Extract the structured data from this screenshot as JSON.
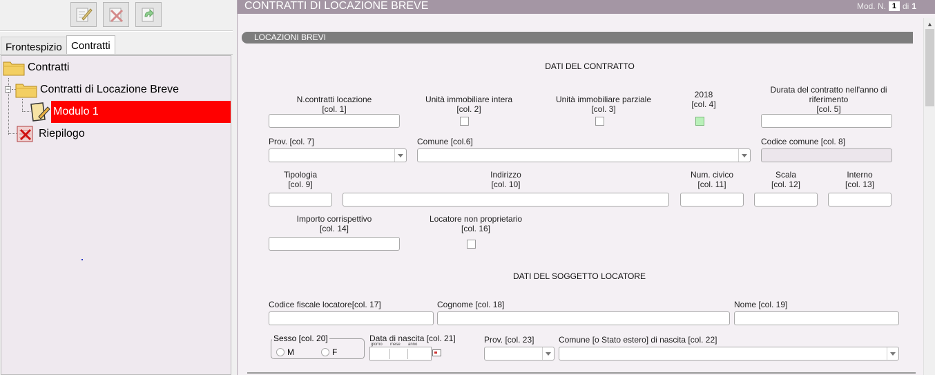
{
  "toolbar": {
    "buttons": [
      {
        "name": "edit",
        "icon": "edit-icon"
      },
      {
        "name": "delete",
        "icon": "delete-icon"
      },
      {
        "name": "refresh",
        "icon": "refresh-icon"
      }
    ]
  },
  "tabs": {
    "frontespizio": "Frontespizio",
    "contratti": "Contratti"
  },
  "tree": {
    "root": "Contratti",
    "child": "Contratti di Locazione Breve",
    "leaf": "Modulo 1",
    "riepilogo": "Riepilogo"
  },
  "header": {
    "title": "CONTRATTI DI LOCAZIONE BREVE",
    "mod_label": "Mod. N.",
    "mod_value": "1",
    "mod_of": "di",
    "mod_total": "1"
  },
  "section": {
    "title": "LOCAZIONI BREVI"
  },
  "contratto": {
    "heading": "DATI DEL CONTRATTO",
    "n_contratti": {
      "l1": "N.contratti locazione",
      "l2": "[col. 1]"
    },
    "unita_intera": {
      "l1": "Unità immobiliare intera",
      "l2": "[col. 2]"
    },
    "unita_parziale": {
      "l1": "Unità immobiliare parziale",
      "l2": "[col. 3]"
    },
    "anno": {
      "l1": "2018",
      "l2": "[col. 4]"
    },
    "durata": {
      "l1": "Durata del contratto nell'anno di",
      "l2": "riferimento",
      "l3": "[col. 5]"
    },
    "prov": "Prov. [col. 7]",
    "comune": "Comune [col.6]",
    "codice_comune": "Codice comune [col. 8]",
    "tipologia": {
      "l1": "Tipologia",
      "l2": "[col. 9]"
    },
    "indirizzo": {
      "l1": "Indirizzo",
      "l2": "[col. 10]"
    },
    "num_civico": {
      "l1": "Num. civico",
      "l2": "[col. 11]"
    },
    "scala": {
      "l1": "Scala",
      "l2": "[col. 12]"
    },
    "interno": {
      "l1": "Interno",
      "l2": "[col. 13]"
    },
    "importo": {
      "l1": "Importo corrispettivo",
      "l2": "[col. 14]"
    },
    "locatore_non_prop": {
      "l1": "Locatore non proprietario",
      "l2": "[col. 16]"
    }
  },
  "locatore": {
    "heading": "DATI DEL SOGGETTO LOCATORE",
    "codice_fiscale": "Codice fiscale locatore[col. 17]",
    "cognome": "Cognome [col. 18]",
    "nome": "Nome [col. 19]",
    "sesso": "Sesso  [col. 20]",
    "sesso_m": "M",
    "sesso_f": "F",
    "data_nascita": "Data di nascita [col. 21]",
    "giorno": "giorno",
    "mese": "mese",
    "anno": "anno",
    "prov": "Prov. [col. 23]",
    "comune_nascita": "Comune [o Stato estero] di nascita [col. 22]"
  }
}
